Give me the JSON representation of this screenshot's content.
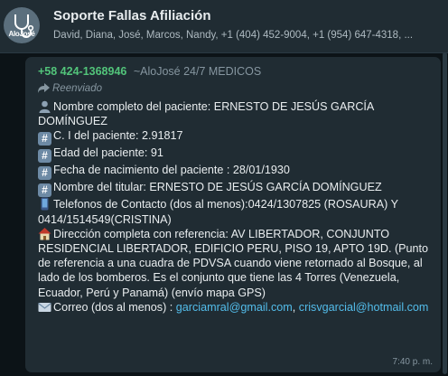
{
  "header": {
    "avatar_brand": "AloJosé",
    "title": "Soporte Fallas Afiliación",
    "members": "David, Diana, José, Marcos, Nandy, +1 (404) 452-9004, +1 (954) 647-4318, ..."
  },
  "message": {
    "sender_phone": "+58 424-1368946",
    "sender_push_name": "~AloJosé 24/7 MEDICOS",
    "forwarded_label": "Reenviado",
    "lines": {
      "l1": "Nombre completo del paciente: ERNESTO DE JESÚS GARCÍA DOMÍNGUEZ",
      "l2": "C. I del paciente: 2.91817",
      "l3": "Edad del paciente: 91",
      "l4": "Fecha de nacimiento del paciente : 28/01/1930",
      "l5": "Nombre del titular: ERNESTO DE JESÚS GARCÍA DOMÍNGUEZ",
      "l6": "Telefonos de Contacto (dos al menos):0424/1307825 (ROSAURA) Y 0414/1514549(CRISTINA)",
      "l7": "Dirección completa con referencia: AV LIBERTADOR, CONJUNTO RESIDENCIAL LIBERTADOR, EDIFICIO PERU, PISO 19, APTO 19D. (Punto de referencia a una cuadra de PDVSA cuando viene retornado al Bosque, al lado de los bomberos. Es el conjunto que tiene las 4 Torres (Venezuela, Ecuador, Perú y Panamá) (envío mapa GPS)",
      "l8_prefix": "Correo (dos al menos) : ",
      "email1": "garciamral@gmail.com",
      "l8_sep": ",",
      "email2": "crisvgarcial@hotmail.com"
    },
    "time": "7:40 p. m."
  },
  "icons": {
    "bust": "bust-in-silhouette-icon",
    "hash": "keycap-hash-icon",
    "phone": "mobile-phone-icon",
    "house": "house-icon",
    "mail": "envelope-icon",
    "forward": "forward-arrow-icon"
  },
  "colors": {
    "bubble": "#202c33",
    "sender": "#52c47a",
    "link": "#53bdeb"
  }
}
